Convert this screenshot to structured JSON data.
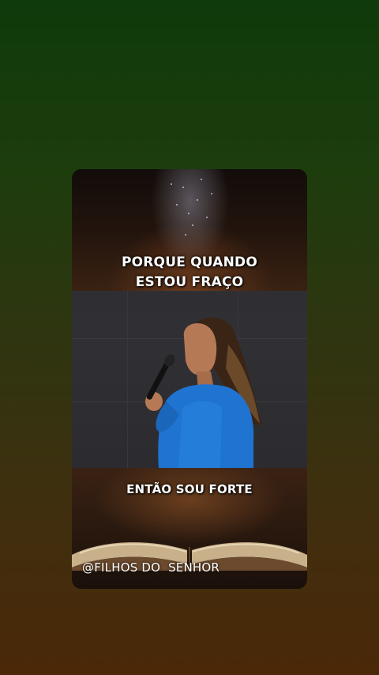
{
  "captions": {
    "top_line1": "PORQUE QUANDO",
    "top_line2": "ESTOU FRAÇO",
    "bottom": "ENTÃO SOU FORTE"
  },
  "watermark": {
    "handle": "@FILHOS DO  SENHOR"
  },
  "colors": {
    "background_top": "#0f3a0b",
    "background_bottom": "#4a2808",
    "jacket": "#1f74d2",
    "caption_text": "#ffffff"
  }
}
